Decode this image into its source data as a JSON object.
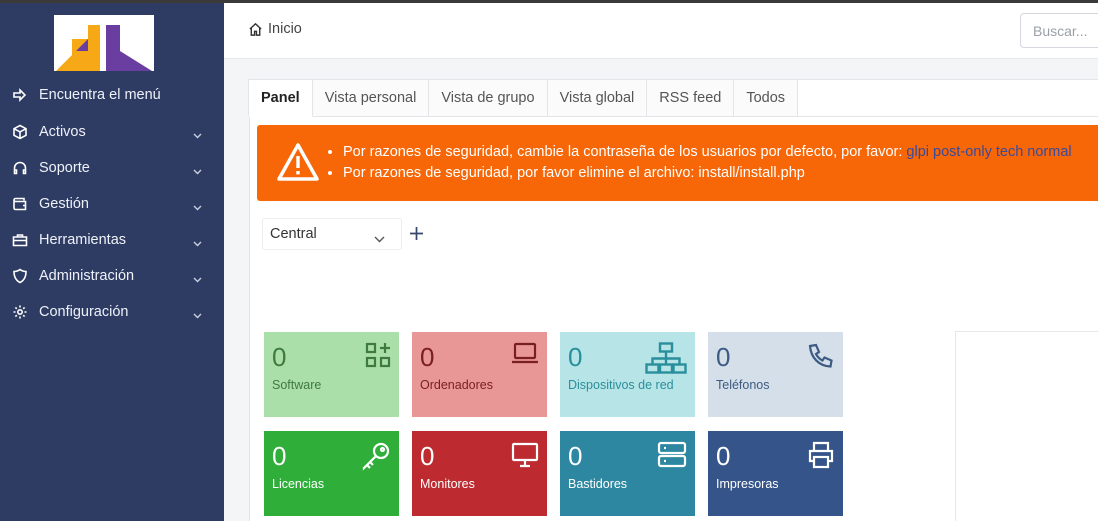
{
  "sidebar": {
    "items": [
      {
        "label": "Encuentra el menú",
        "icon": "arrow-right-icon"
      },
      {
        "label": "Activos",
        "icon": "cube-icon"
      },
      {
        "label": "Soporte",
        "icon": "headset-icon"
      },
      {
        "label": "Gestión",
        "icon": "wallet-icon"
      },
      {
        "label": "Herramientas",
        "icon": "briefcase-icon"
      },
      {
        "label": "Administración",
        "icon": "shield-icon"
      },
      {
        "label": "Configuración",
        "icon": "gear-icon"
      }
    ],
    "bg_color": "#2e3c64"
  },
  "header": {
    "breadcrumb": "Inicio",
    "search_placeholder": "Buscar..."
  },
  "tabs": [
    "Panel",
    "Vista personal",
    "Vista de grupo",
    "Vista global",
    "RSS feed",
    "Todos"
  ],
  "alert": {
    "line1": "Por razones de seguridad, cambie la contraseña de los usuarios por defecto, por favor: ",
    "line1_links": "glpi post-only tech normal",
    "line2": "Por razones de seguridad, por favor elimine el archivo: install/install.php",
    "color": "#f76707"
  },
  "dashboard": {
    "selected": "Central"
  },
  "tiles": [
    {
      "value": "0",
      "label": "Software",
      "icon": "apps-add-icon",
      "bg": "#aadfaa",
      "fg": "#3f7a3f"
    },
    {
      "value": "0",
      "label": "Ordenadores",
      "icon": "laptop-icon",
      "bg": "#e99696",
      "fg": "#7a1f1f"
    },
    {
      "value": "0",
      "label": "Dispositivos de red",
      "icon": "network-icon",
      "bg": "#b7e4e6",
      "fg": "#2a8f9c"
    },
    {
      "value": "0",
      "label": "Teléfonos",
      "icon": "phone-icon",
      "bg": "#d5dfe9",
      "fg": "#3d5b82"
    },
    {
      "value": "0",
      "label": "Licencias",
      "icon": "key-icon",
      "bg": "#2faf3a",
      "fg": "#ffffff"
    },
    {
      "value": "0",
      "label": "Monitores",
      "icon": "monitor-icon",
      "bg": "#bd2b30",
      "fg": "#ffffff"
    },
    {
      "value": "0",
      "label": "Bastidores",
      "icon": "server-icon",
      "bg": "#2d87a1",
      "fg": "#ffffff"
    },
    {
      "value": "0",
      "label": "Impresoras",
      "icon": "printer-icon",
      "bg": "#35558a",
      "fg": "#ffffff"
    }
  ]
}
